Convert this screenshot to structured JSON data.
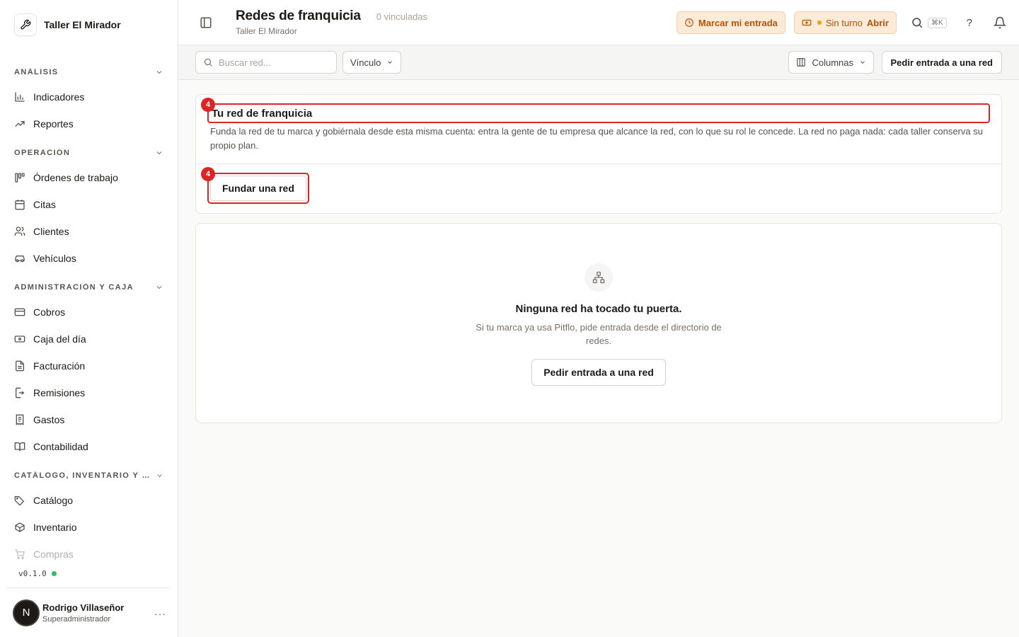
{
  "brand": {
    "name": "Taller El Mirador",
    "icon": "wrench-icon"
  },
  "sidebar": {
    "groups": [
      {
        "title": "ANÁLISIS",
        "items": [
          {
            "label": "Indicadores",
            "icon": "bar-chart-icon"
          },
          {
            "label": "Reportes",
            "icon": "trending-up-icon"
          }
        ]
      },
      {
        "title": "OPERACIÓN",
        "items": [
          {
            "label": "Órdenes de trabajo",
            "icon": "kanban-icon"
          },
          {
            "label": "Citas",
            "icon": "calendar-icon"
          },
          {
            "label": "Clientes",
            "icon": "users-icon"
          },
          {
            "label": "Vehículos",
            "icon": "car-icon"
          }
        ]
      },
      {
        "title": "ADMINISTRACIÓN Y CAJA",
        "items": [
          {
            "label": "Cobros",
            "icon": "credit-card-icon"
          },
          {
            "label": "Caja del día",
            "icon": "banknote-icon"
          },
          {
            "label": "Facturación",
            "icon": "file-text-icon"
          },
          {
            "label": "Remisiones",
            "icon": "file-export-icon"
          },
          {
            "label": "Gastos",
            "icon": "receipt-icon"
          },
          {
            "label": "Contabilidad",
            "icon": "book-open-icon"
          }
        ]
      },
      {
        "title": "CATÁLOGO, INVENTARIO Y CO...",
        "items": [
          {
            "label": "Catálogo",
            "icon": "tags-icon"
          },
          {
            "label": "Inventario",
            "icon": "package-icon"
          },
          {
            "label": "Compras",
            "icon": "cart-icon"
          }
        ]
      }
    ],
    "version": "v0.1.0",
    "user": {
      "initial": "N",
      "name": "Rodrigo Villaseñor",
      "role": "Superadministrador",
      "more": "···"
    }
  },
  "header": {
    "title": "Redes de franquicia",
    "count": "0 vinculadas",
    "subtitle": "Taller El Mirador",
    "clock_in_label": "Marcar mi entrada",
    "shift_label": "Sin turno",
    "shift_open_label": "Abrir",
    "shortcut": "⌘K",
    "help": "?"
  },
  "toolbar": {
    "search_placeholder": "Buscar red...",
    "filter_label": "Vínculo",
    "columns_label": "Columnas",
    "request_label": "Pedir entrada a una red"
  },
  "own_network": {
    "title": "Tu red de franquicia",
    "description": "Funda la red de tu marca y gobiérnala desde esta misma cuenta: entra la gente de tu empresa que alcance la red, con lo que su rol le concede. La red no paga nada: cada taller conserva su propio plan.",
    "found_label": "Fundar una red",
    "badge_title": "4",
    "badge_button": "4"
  },
  "empty_state": {
    "icon": "network-icon",
    "title": "Ninguna red ha tocado tu puerta.",
    "description": "Si tu marca ya usa Pitflo, pide entrada desde el directorio de redes.",
    "button_label": "Pedir entrada a una red"
  },
  "colors": {
    "accent_warning": "#b45309",
    "highlight": "#dc2626",
    "status_ok": "#22c55e"
  }
}
